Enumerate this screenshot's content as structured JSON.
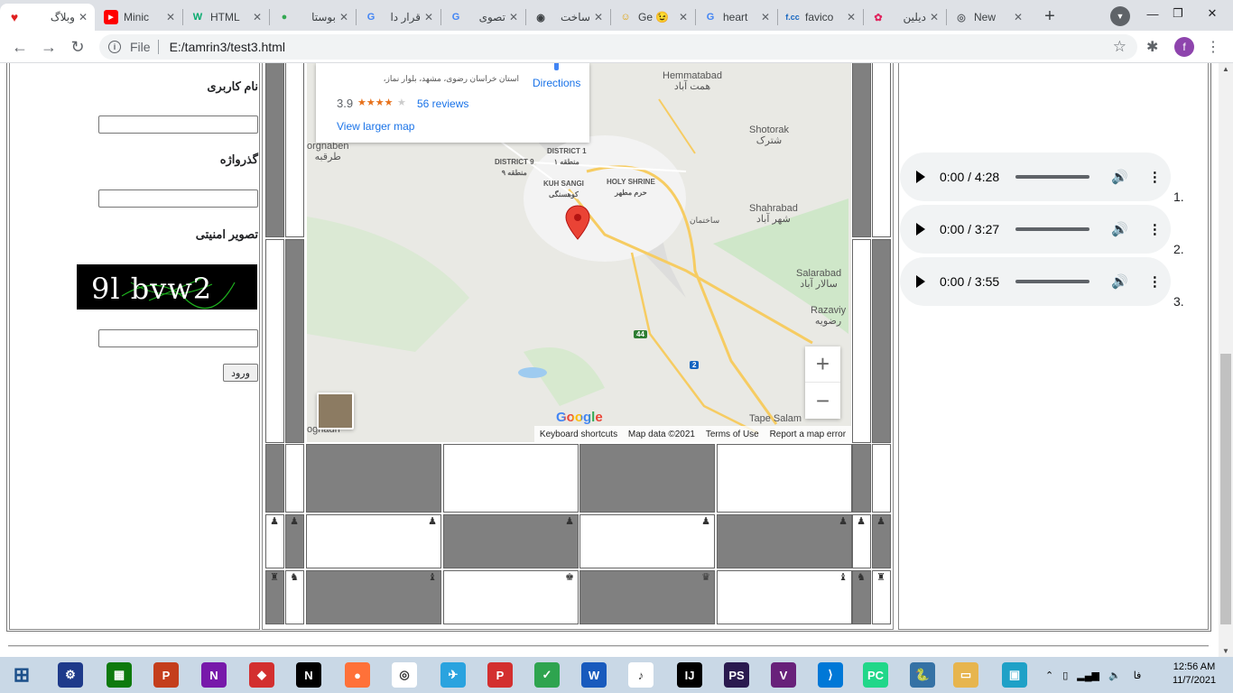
{
  "browser": {
    "tabs": [
      {
        "title": "وبلاگ",
        "icon": "heart-icon"
      },
      {
        "title": "Minic",
        "icon": "youtube-icon"
      },
      {
        "title": "HTML",
        "icon": "w3schools-icon"
      },
      {
        "title": "بوستا",
        "icon": "maps-icon"
      },
      {
        "title": "قرار دا",
        "icon": "google-icon"
      },
      {
        "title": "تصوی",
        "icon": "google-icon"
      },
      {
        "title": "ساخت",
        "icon": "globe-icon"
      },
      {
        "title": "Ge 😉",
        "icon": "emoji-icon"
      },
      {
        "title": "heart",
        "icon": "google-icon"
      },
      {
        "title": "favico",
        "icon": "favicon-cc-icon"
      },
      {
        "title": "دیلین",
        "icon": "dribbble-icon"
      },
      {
        "title": "New",
        "icon": "chrome-icon"
      }
    ],
    "url_scheme": "File",
    "url": "E:/tamrin3/test3.html",
    "profile_initial": "f"
  },
  "form": {
    "username_label": "نام کاربری",
    "password_label": "گذرواژه",
    "captcha_label": "تصویر امنیتی",
    "captcha_text": "9l bvw2",
    "submit_label": "ورود"
  },
  "map": {
    "place_address": "استان خراسان رضوی، مشهد، بلوار نماز،",
    "rating": "3.9",
    "stars": "★★★★",
    "star_empty": "★",
    "reviews": "56 reviews",
    "directions": "Directions",
    "view_larger": "View larger map",
    "google_logo": "Google",
    "footer": {
      "shortcuts": "Keyboard shortcuts",
      "data": "Map data ©2021",
      "terms": "Terms of Use",
      "report": "Report a map error"
    },
    "places": [
      {
        "en": "Hemmatabad",
        "fa": "همت آباد"
      },
      {
        "en": "Shotorak",
        "fa": "شترک"
      },
      {
        "en": "Shahrabad",
        "fa": "شهر آباد"
      },
      {
        "en": "Salarabad",
        "fa": "سالار آباد"
      },
      {
        "en": "Razaviy",
        "fa": "رضویه"
      },
      {
        "en": "Tape Salam",
        "fa": ""
      },
      {
        "en": "DISTRICT 1",
        "fa": "منطقه ۱"
      },
      {
        "en": "DISTRICT 9",
        "fa": "منطقه ۹"
      },
      {
        "en": "KUH SANGI",
        "fa": "کوهسنگی"
      },
      {
        "en": "HOLY SHRINE",
        "fa": "حرم مطهر"
      },
      {
        "en": "orgnaben",
        "fa": "طرقبه"
      },
      {
        "en": "ognadh",
        "fa": ""
      },
      {
        "en": "",
        "fa": "ساختمان"
      }
    ],
    "road_badges": [
      "44",
      "2"
    ]
  },
  "audio": [
    {
      "number": "1.",
      "time": "0:00 / 4:28"
    },
    {
      "number": "2.",
      "time": "0:00 / 3:27"
    },
    {
      "number": "3.",
      "time": "0:00 / 3:55"
    }
  ],
  "chess": {
    "pawn": "♟",
    "row_back": [
      "♜",
      "♞",
      "♝",
      "♚",
      "♛",
      "♝",
      "♞",
      "♜"
    ]
  },
  "taskbar": {
    "apps": [
      "settings-icon",
      "store-icon",
      "powerpoint-icon",
      "onenote-icon",
      "anydesk-icon",
      "netflix-icon",
      "firefox-icon",
      "chrome-icon",
      "telegram-icon",
      "psiphon-icon",
      "vpn-icon",
      "word-icon",
      "tiktok-icon",
      "intellij-icon",
      "phpstorm-icon",
      "visual-studio-icon",
      "vscode-icon",
      "pycharm-icon",
      "python-icon",
      "file-explorer-icon",
      "photos-icon"
    ],
    "language": "فا",
    "time": "12:56 AM",
    "date": "11/7/2021"
  }
}
